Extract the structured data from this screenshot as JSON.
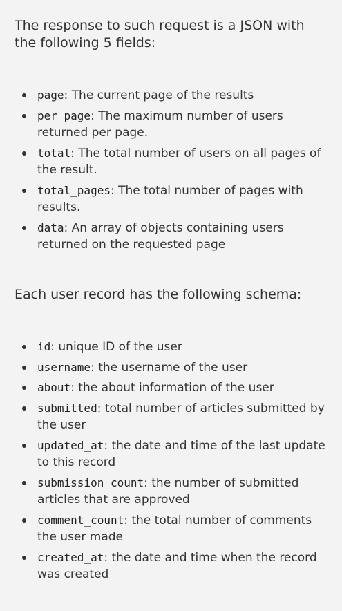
{
  "intro_text": "The response to such request is a JSON with the following 5 fields:",
  "response_fields": [
    {
      "name": "page",
      "desc": ": The current page of the results"
    },
    {
      "name": "per_page",
      "desc": ": The maximum number of users returned per page."
    },
    {
      "name": "total",
      "desc": ": The total number of users on all pages of the result."
    },
    {
      "name": "total_pages",
      "desc": ": The total number of pages with results."
    },
    {
      "name": "data",
      "desc": ": An array of objects containing users returned on the requested page"
    }
  ],
  "schema_intro_text": "Each user record has the following schema:",
  "schema_fields": [
    {
      "name": "id",
      "desc": ": unique ID of the user"
    },
    {
      "name": "username",
      "desc": ": the username of the user"
    },
    {
      "name": "about",
      "desc": ": the about information of the user"
    },
    {
      "name": "submitted",
      "desc": ": total number of articles submitted by the user"
    },
    {
      "name": "updated_at",
      "desc": ": the date and time of the last update to this record"
    },
    {
      "name": "submission_count",
      "desc": ": the number of submitted articles that are approved"
    },
    {
      "name": "comment_count",
      "desc": ": the total number of comments the user made"
    },
    {
      "name": "created_at",
      "desc": ": the date and time when the record was created"
    }
  ]
}
